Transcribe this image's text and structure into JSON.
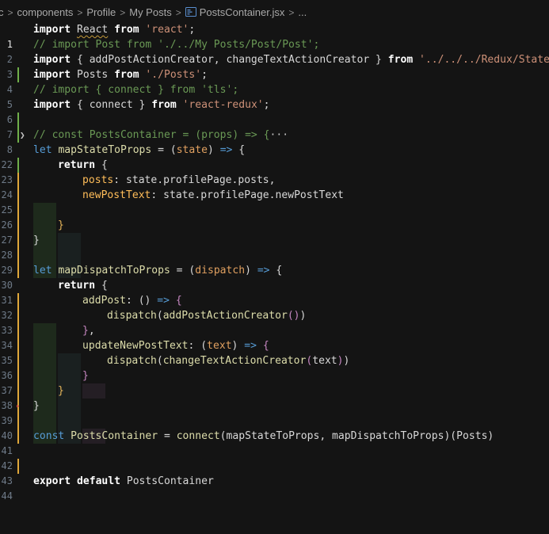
{
  "breadcrumb": {
    "items": [
      "c",
      "components",
      "Profile",
      "My Posts",
      "PostsContainer.jsx",
      "..."
    ]
  },
  "colors": {
    "background": "#141414",
    "added_line": "#6fae4a",
    "modified_line": "#e0a83a",
    "keyword": "#569cd6",
    "string": "#ce9178",
    "comment": "#6a9955"
  },
  "lines": [
    {
      "n": "1",
      "text": "import React from 'react';"
    },
    {
      "n": "2",
      "text": "// import Post from './../My Posts/Post/Post';"
    },
    {
      "n": "3",
      "text": "import { addPostActionCreator, changeTextActionCreator } from '../../../Redux/State';"
    },
    {
      "n": "4",
      "text": "import Posts from './Posts';"
    },
    {
      "n": "5",
      "text": "// import { connect } from 'tls';"
    },
    {
      "n": "6",
      "text": "import { connect } from 'react-redux';"
    },
    {
      "n": "7",
      "text": ""
    },
    {
      "n": "8",
      "text": "// const PostsContainer = (props) => {···"
    },
    {
      "n": "22",
      "text": "let mapStateToProps = (state) => {"
    },
    {
      "n": "23",
      "text": "return {"
    },
    {
      "n": "24",
      "text": "posts: state.profilePage.posts,"
    },
    {
      "n": "25",
      "text": "newPostText: state.profilePage.newPostText"
    },
    {
      "n": "26",
      "text": ""
    },
    {
      "n": "27",
      "text": "}"
    },
    {
      "n": "28",
      "text": "}"
    },
    {
      "n": "29",
      "text": ""
    },
    {
      "n": "30",
      "text": "let mapDispatchToProps = (dispatch) => {"
    },
    {
      "n": "31",
      "text": "return {"
    },
    {
      "n": "32",
      "text": "addPost: () => {"
    },
    {
      "n": "33",
      "text": "dispatch(addPostActionCreator())"
    },
    {
      "n": "34",
      "text": "},"
    },
    {
      "n": "35",
      "text": "updateNewPostText: (text) => {"
    },
    {
      "n": "36",
      "text": "dispatch(changeTextActionCreator(text))"
    },
    {
      "n": "37",
      "text": "}"
    },
    {
      "n": "38",
      "text": "}"
    },
    {
      "n": "39",
      "text": "}"
    },
    {
      "n": "40",
      "text": ""
    },
    {
      "n": "41",
      "text": "const PostsContainer = connect(mapStateToProps, mapDispatchToProps)(Posts)"
    },
    {
      "n": "42",
      "text": ""
    },
    {
      "n": "43",
      "text": ""
    },
    {
      "n": "44",
      "text": "export default PostsContainer"
    }
  ]
}
